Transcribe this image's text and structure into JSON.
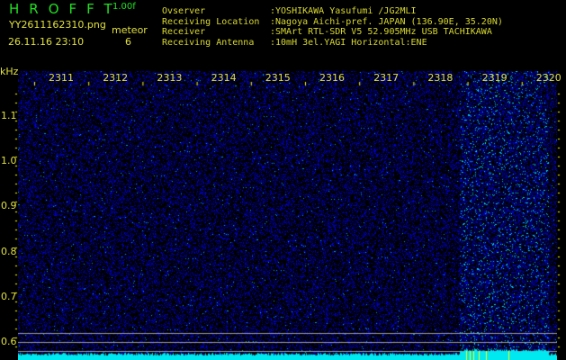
{
  "header": {
    "title": "HROFFT",
    "version": "1.00f",
    "filename": "YY2611162310.png",
    "datetime": "26.11.16 23:10",
    "meteor_label": "meteor",
    "meteor_count": "6"
  },
  "info": [
    {
      "key": "Ovserver",
      "value": ":YOSHIKAWA Yasufumi /JG2MLI"
    },
    {
      "key": "Receiving Location",
      "value": ":Nagoya Aichi-pref. JAPAN (136.90E, 35.20N)"
    },
    {
      "key": "Receiver",
      "value": ":SMArt RTL-SDR V5 52.905MHz USB TACHIKAWA"
    },
    {
      "key": "Receiving Antenna",
      "value": ":10mH 3el.YAGI Horizontal:ENE"
    }
  ],
  "axis": {
    "y_unit": "kHz",
    "x_labels": [
      "2311",
      "2312",
      "2313",
      "2314",
      "2315",
      "2316",
      "2317",
      "2318",
      "2319",
      "2320"
    ],
    "y_labels": [
      "1.1",
      "1.0",
      "0.9",
      "0.8",
      "0.7",
      "0.6"
    ]
  },
  "colors": {
    "text": "#e0e040",
    "title": "#20e020",
    "noise": "#0000c0",
    "baseline": "#00e8f0"
  }
}
